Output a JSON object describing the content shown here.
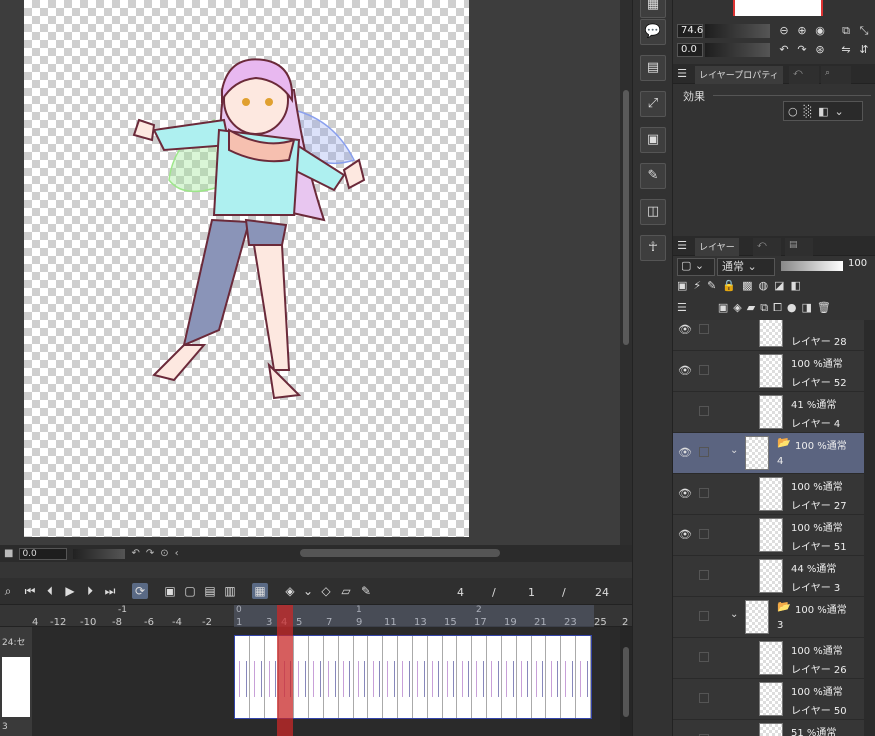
{
  "canvas_status": {
    "angle_value": "0.0"
  },
  "navigator": {
    "zoom_value": "74.6",
    "rotate_value": "0.0"
  },
  "layer_property": {
    "tabs": [
      "レイヤープロパティ"
    ],
    "effect_label": "効果"
  },
  "layer_panel": {
    "tab_label": "レイヤー",
    "blend_mode": "通常",
    "opacity": "100"
  },
  "layers": [
    {
      "mode": "",
      "name": "レイヤー 28",
      "visible": true,
      "type": "layer",
      "indent": 1,
      "selected": false
    },
    {
      "mode": "100 %通常",
      "name": "レイヤー 52",
      "visible": true,
      "type": "layer",
      "indent": 1,
      "selected": false
    },
    {
      "mode": "41 %通常",
      "name": "レイヤー 4",
      "visible": false,
      "type": "layer",
      "indent": 1,
      "selected": false
    },
    {
      "mode": "100 %通常",
      "name": "4",
      "visible": true,
      "type": "folder",
      "indent": 0,
      "selected": true
    },
    {
      "mode": "100 %通常",
      "name": "レイヤー 27",
      "visible": true,
      "type": "layer",
      "indent": 1,
      "selected": false
    },
    {
      "mode": "100 %通常",
      "name": "レイヤー 51",
      "visible": true,
      "type": "layer",
      "indent": 1,
      "selected": false
    },
    {
      "mode": "44 %通常",
      "name": "レイヤー 3",
      "visible": false,
      "type": "layer",
      "indent": 1,
      "selected": false
    },
    {
      "mode": "100 %通常",
      "name": "3",
      "visible": false,
      "type": "folder",
      "indent": 0,
      "selected": false
    },
    {
      "mode": "100 %通常",
      "name": "レイヤー 26",
      "visible": false,
      "type": "layer",
      "indent": 1,
      "selected": false
    },
    {
      "mode": "100 %通常",
      "name": "レイヤー 50",
      "visible": false,
      "type": "layer",
      "indent": 1,
      "selected": false
    },
    {
      "mode": "51 %通常",
      "name": "",
      "visible": false,
      "type": "layer",
      "indent": 1,
      "selected": false
    }
  ],
  "timeline": {
    "current_frame": "4",
    "sep1": "/",
    "page": "1",
    "sep2": "/",
    "total_frames": "24",
    "track_label": "24:セ",
    "bottom_label": "3",
    "ruler_ticks": [
      "4",
      "-12",
      "-10",
      "-8",
      "-6",
      "-4",
      "-2",
      "1",
      "3",
      "4",
      "5",
      "7",
      "9",
      "11",
      "13",
      "15",
      "17",
      "19",
      "21",
      "23",
      "25",
      "2"
    ],
    "ruler_top": [
      "-1",
      "0",
      "1",
      "2"
    ],
    "frame_count": 24
  }
}
